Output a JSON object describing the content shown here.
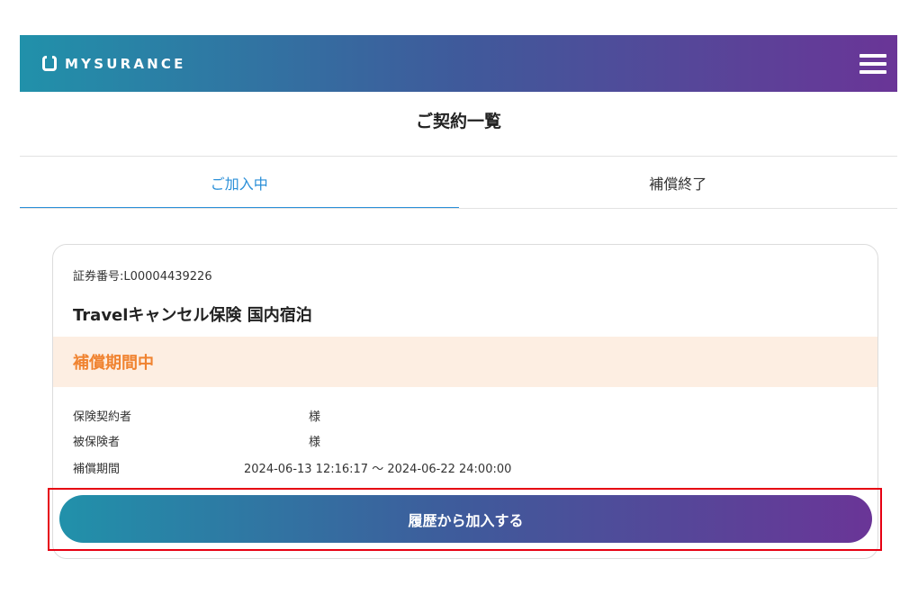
{
  "header": {
    "brand": "MYSURANCE",
    "logo_icon": "shopping-bag-icon",
    "menu_icon": "hamburger-menu-icon",
    "gradient": [
      "#2191aa",
      "#6a3597"
    ]
  },
  "page": {
    "title": "ご契約一覧"
  },
  "tabs": [
    {
      "label": "ご加入中",
      "active": true
    },
    {
      "label": "補償終了",
      "active": false
    }
  ],
  "colors": {
    "tab_active": "#2a8fd8",
    "status_accent": "#f08330",
    "status_band": "#fdeee2",
    "highlight": "#e60012"
  },
  "policy": {
    "number_label": "証券番号:L00004439226",
    "product_name": "Travelキャンセル保険 国内宿泊",
    "status": "補償期間中",
    "details": [
      {
        "label": "保険契約者",
        "value": "様"
      },
      {
        "label": "被保険者",
        "value": "様"
      },
      {
        "label": "補償期間",
        "value": "2024-06-13 12:16:17 ～ 2024-06-22 24:00:00"
      }
    ],
    "action_label": "履歴から加入する"
  }
}
